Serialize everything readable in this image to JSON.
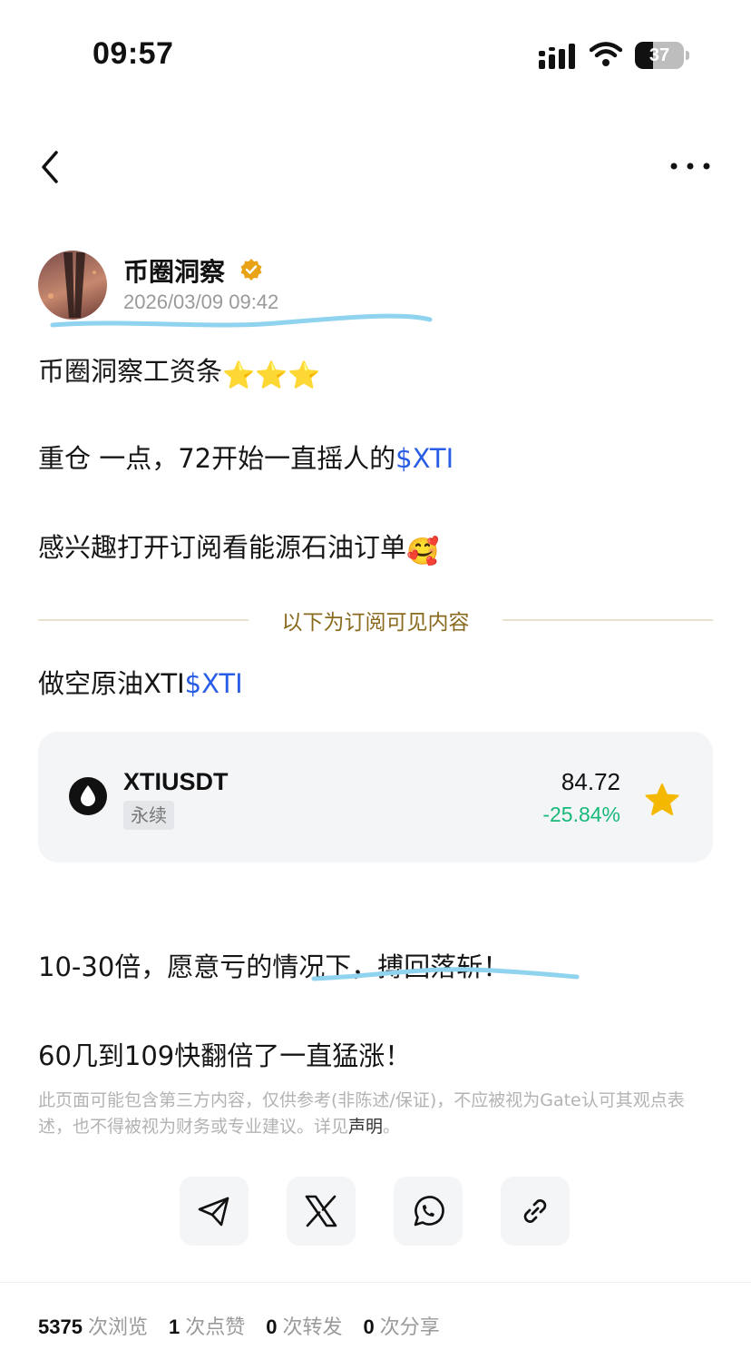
{
  "status_bar": {
    "time": "09:57",
    "battery_level": 37,
    "battery_text": "37"
  },
  "nav": {
    "back_icon": "chevron-left-icon",
    "more_icon": "ellipsis-icon"
  },
  "author": {
    "name": "币圈洞察",
    "timestamp": "2026/03/09 09:42",
    "verified_icon": "verified-badge-icon"
  },
  "post": {
    "title_text": "币圈洞察工资条",
    "title_emoji": "⭐⭐⭐",
    "line2_text": "重仓 一点，72开始一直摇人的",
    "line2_ticker": "$XTI",
    "line3_text": "感兴趣打开订阅看能源石油订单",
    "line3_emoji": "🥰",
    "divider_label": "以下为订阅可见内容",
    "line4_text": "做空原油XTI",
    "line4_ticker": "$XTI",
    "line5_text": "10-30倍，愿意亏的情况下，搏回落斩！",
    "line6_text": "60几到109快翻倍了一直猛涨！"
  },
  "ticker_card": {
    "symbol": "XTIUSDT",
    "tag": "永续",
    "price": "84.72",
    "change": "-25.84%",
    "change_color": "#16b97a",
    "favorite_icon": "star-icon"
  },
  "disclaimer": {
    "text": "此页面可能包含第三方内容，仅供参考(非陈述/保证)，不应被视为Gate认可其观点表述，也不得被视为财务或专业建议。详见",
    "link": "声明",
    "end": "。"
  },
  "share_buttons": [
    {
      "icon": "telegram-icon"
    },
    {
      "icon": "x-icon"
    },
    {
      "icon": "whatsapp-icon"
    },
    {
      "icon": "link-icon"
    }
  ],
  "stats": {
    "views": "5375",
    "views_label": "次浏览",
    "likes": "1",
    "likes_label": "次点赞",
    "reposts": "0",
    "reposts_label": "次转发",
    "shares": "0",
    "shares_label": "次分享"
  },
  "colors": {
    "link": "#2a5de6",
    "accent_gold": "#8a6a1e",
    "positive": "#16b97a",
    "highlight_stroke": "#8fd3ef"
  }
}
